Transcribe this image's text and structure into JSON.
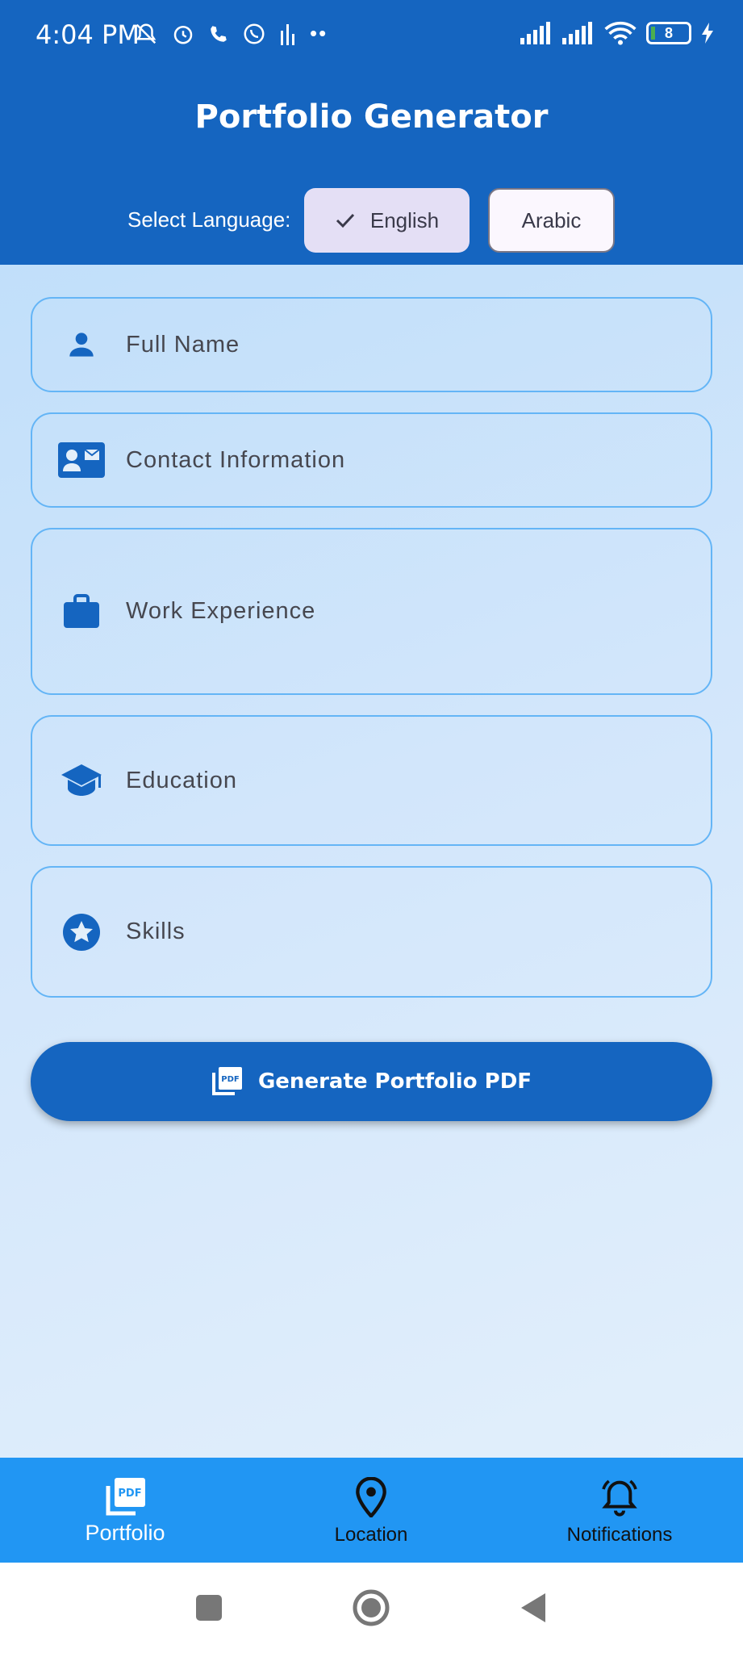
{
  "status_bar": {
    "time": "4:04 PM",
    "battery_level": "8"
  },
  "header": {
    "title": "Portfolio Generator"
  },
  "language": {
    "label": "Select Language:",
    "options": [
      "English",
      "Arabic"
    ],
    "selected": "English"
  },
  "form": {
    "fields": [
      {
        "label": "Full Name",
        "icon": "person-icon"
      },
      {
        "label": "Contact Information",
        "icon": "contact-card-icon"
      },
      {
        "label": "Work Experience",
        "icon": "briefcase-icon"
      },
      {
        "label": "Education",
        "icon": "graduation-cap-icon"
      },
      {
        "label": "Skills",
        "icon": "star-icon"
      }
    ]
  },
  "generate_button": {
    "label": "Generate Portfolio PDF"
  },
  "bottom_nav": {
    "items": [
      {
        "label": "Portfolio",
        "icon": "pdf-icon",
        "active": true
      },
      {
        "label": "Location",
        "icon": "location-pin-icon",
        "active": false
      },
      {
        "label": "Notifications",
        "icon": "bell-icon",
        "active": false
      }
    ]
  },
  "colors": {
    "primary": "#1565c0",
    "nav_bar": "#2196f3",
    "field_border": "#64b5f6",
    "chip_selected": "#e4dff5"
  }
}
